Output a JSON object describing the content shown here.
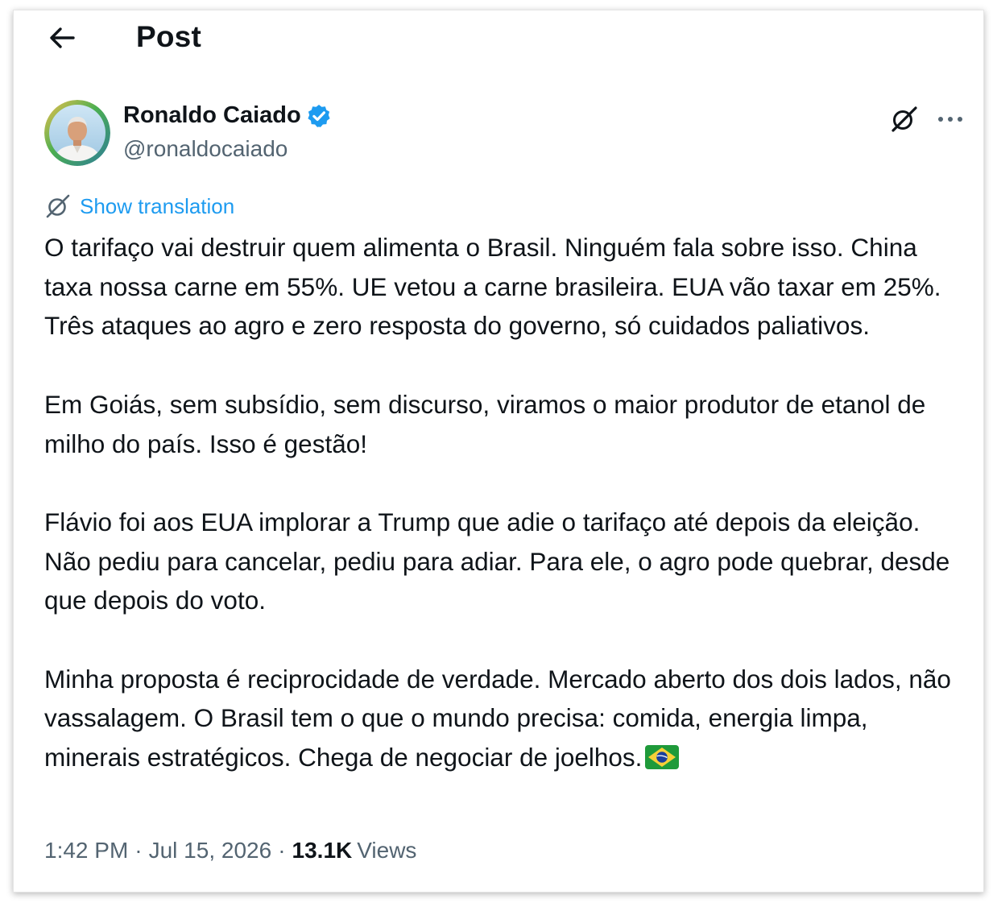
{
  "header": {
    "title": "Post",
    "back_icon": "arrow-left-icon"
  },
  "author": {
    "display_name": "Ronaldo Caiado",
    "handle": "@ronaldocaiado",
    "verified": true,
    "verified_color": "#1d9bf0"
  },
  "actions": {
    "grok_icon": "grok-icon",
    "more_icon": "more-horizontal-icon"
  },
  "translation": {
    "label": "Show translation",
    "icon": "translate-icon",
    "color": "#1d9bf0"
  },
  "tweet": {
    "paragraphs": [
      "O tarifaço vai destruir quem alimenta o Brasil. Ninguém fala sobre isso. China taxa nossa carne em 55%. UE vetou a carne brasileira. EUA vão taxar em 25%. Três ataques ao agro e zero resposta do governo, só cuidados paliativos.",
      "Em Goiás, sem subsídio, sem discurso, viramos o maior produtor de etanol de milho do país. Isso é gestão!",
      "Flávio foi aos EUA implorar a Trump que adie o tarifaço até depois da eleição. Não pediu para cancelar, pediu para adiar. Para ele, o agro pode quebrar, desde que depois do voto.",
      "Minha proposta é reciprocidade de verdade. Mercado aberto dos dois lados, não vassalagem. O Brasil tem o que o mundo precisa: comida, energia limpa, minerais estratégicos. Chega de negociar de joelhos."
    ],
    "trailing_emoji": "brazil-flag-icon"
  },
  "meta": {
    "time": "1:42 PM",
    "separator": "·",
    "date": "Jul 15, 2026",
    "views_count": "13.1K",
    "views_label": "Views"
  },
  "colors": {
    "text_primary": "#0f1419",
    "text_secondary": "#536471",
    "accent": "#1d9bf0"
  }
}
